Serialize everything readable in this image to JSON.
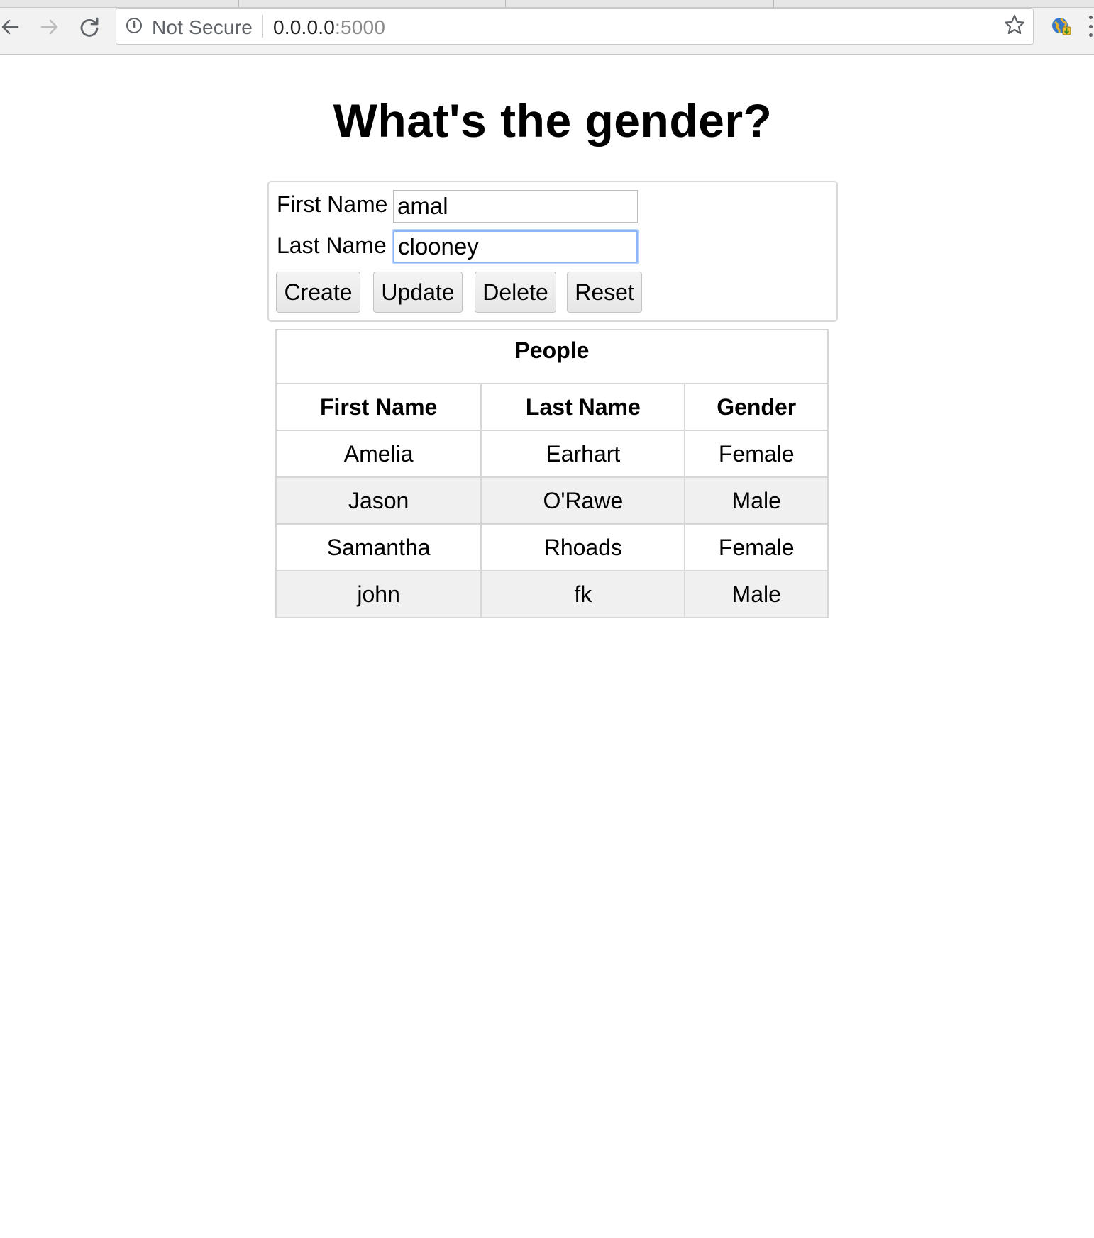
{
  "browser": {
    "security_label": "Not Secure",
    "url_host": "0.0.0.0",
    "url_port": ":5000"
  },
  "page": {
    "title": "What's the gender?"
  },
  "form": {
    "first_name_label": "First Name",
    "first_name_value": "amal",
    "last_name_label": "Last Name",
    "last_name_value": "clooney",
    "buttons": {
      "create": "Create",
      "update": "Update",
      "delete": "Delete",
      "reset": "Reset"
    }
  },
  "table": {
    "caption": "People",
    "headers": [
      "First Name",
      "Last Name",
      "Gender"
    ],
    "rows": [
      [
        "Amelia",
        "Earhart",
        "Female"
      ],
      [
        "Jason",
        "O'Rawe",
        "Male"
      ],
      [
        "Samantha",
        "Rhoads",
        "Female"
      ],
      [
        "john",
        "fk",
        "Male"
      ]
    ]
  }
}
